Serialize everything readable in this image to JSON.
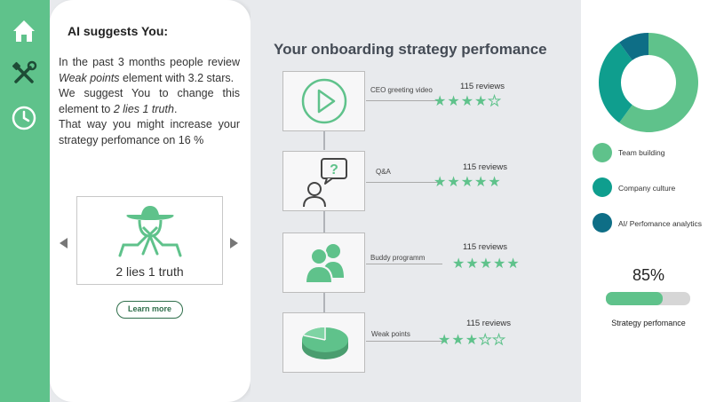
{
  "sidebar": {
    "items": [
      {
        "icon": "home-icon"
      },
      {
        "icon": "tools-icon"
      },
      {
        "icon": "clock-icon"
      }
    ]
  },
  "ai_panel": {
    "title": "AI suggests You:",
    "text": {
      "p1_before": "In the past 3 months people review ",
      "p1_em": "Weak points",
      "p1_after": " element with 3.2 stars.",
      "p2_before": "We suggest You to change this element to ",
      "p2_em": "2 lies 1 truth",
      "p2_after": ".",
      "p3": "That way you might increase your strategy perfomance on 16 %"
    },
    "card": {
      "icon": "cowboy-icon",
      "label": "2 lies 1 truth"
    },
    "learn_more": "Learn more"
  },
  "main": {
    "title": "Your onboarding strategy perfomance",
    "steps": [
      {
        "label": "CEO greeting video",
        "reviews": "115 reviews",
        "rating": 4,
        "icon": "play-icon"
      },
      {
        "label": "Q&A",
        "reviews": "115 reviews",
        "rating": 5,
        "icon": "question-person-icon"
      },
      {
        "label": "Buddy programm",
        "reviews": "115 reviews",
        "rating": 5,
        "icon": "people-icon"
      },
      {
        "label": "Weak points",
        "reviews": "115 reviews",
        "rating": 3,
        "icon": "pie-chart-icon"
      }
    ]
  },
  "right": {
    "donut": {
      "segments": [
        {
          "label": "Team building",
          "value": 0.6,
          "color": "#5fc28b"
        },
        {
          "label": "Company culture",
          "value": 0.3,
          "color": "#0f9e8e"
        },
        {
          "label": "AI/ Perfomance analytics",
          "value": 0.1,
          "color": "#0e6e86"
        }
      ]
    },
    "performance": {
      "percent": "85%",
      "value": 0.67,
      "label": "Strategy perfomance"
    }
  }
}
